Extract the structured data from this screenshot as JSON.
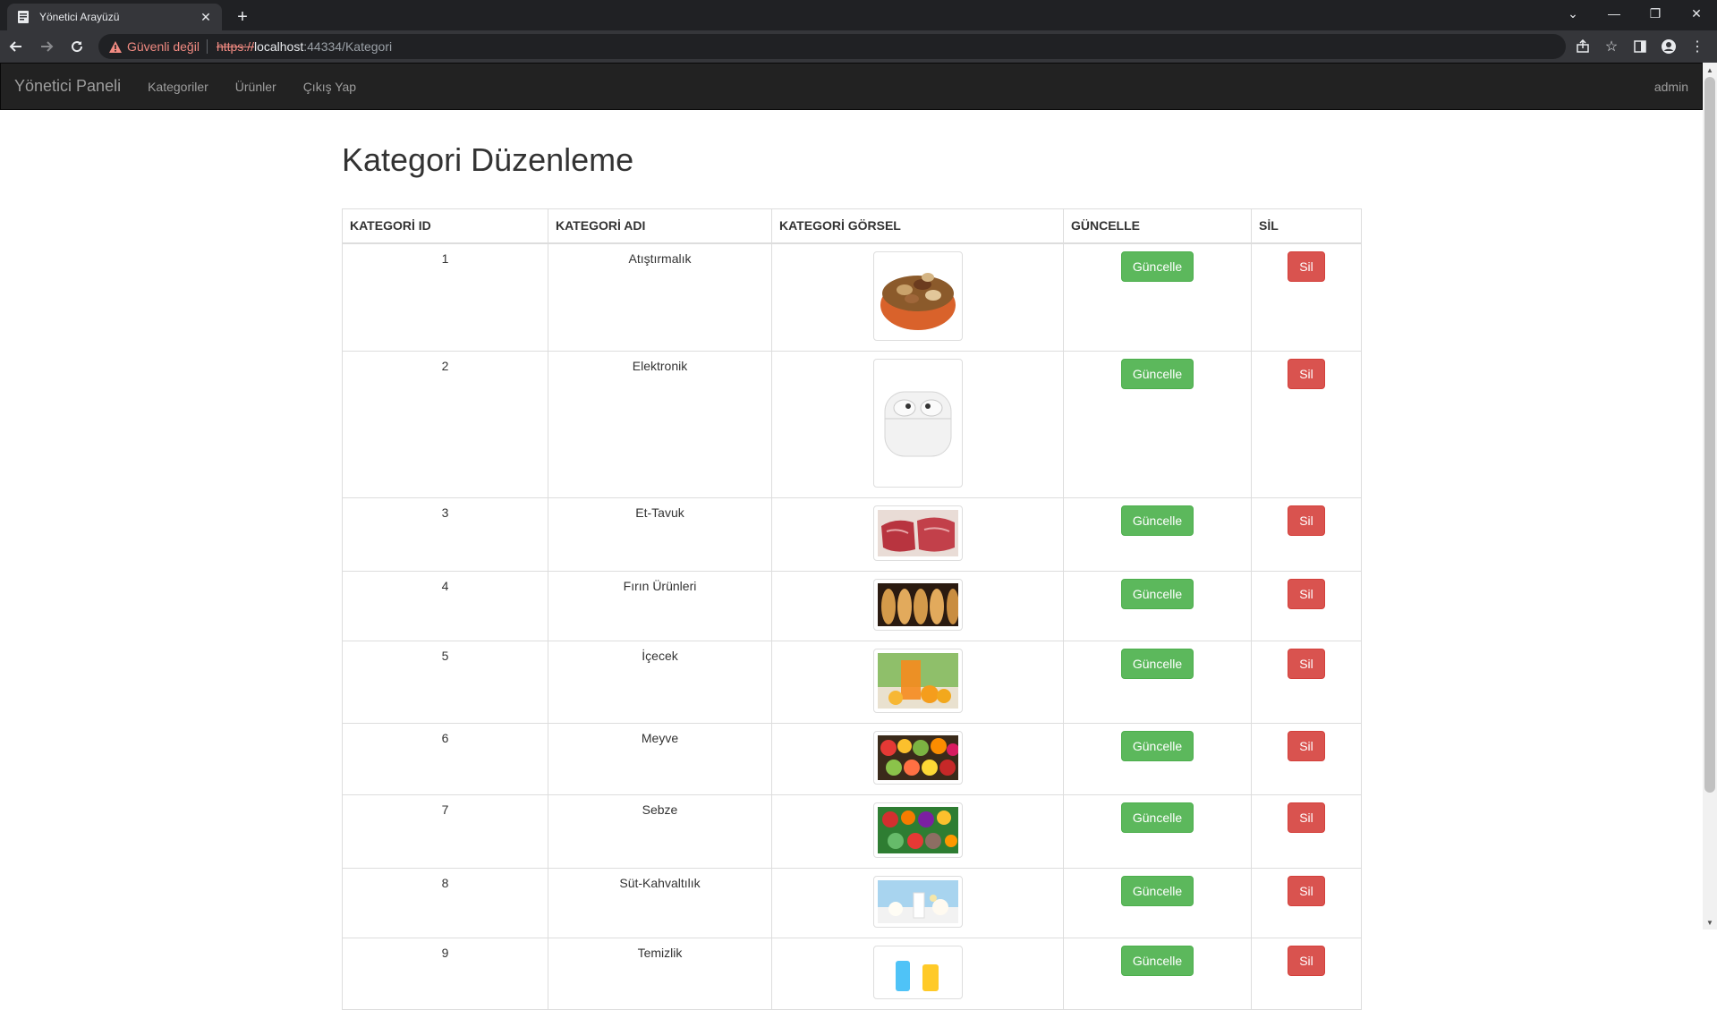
{
  "browser": {
    "tab_title": "Yönetici Arayüzü",
    "security_label": "Güvenli değil",
    "url_scheme": "https://",
    "url_host": "localhost",
    "url_path": ":44334/Kategori"
  },
  "navbar": {
    "brand": "Yönetici Paneli",
    "links": [
      "Kategoriler",
      "Ürünler",
      "Çıkış Yap"
    ],
    "user": "admin"
  },
  "page": {
    "title": "Kategori Düzenleme",
    "columns": [
      "KATEGORİ ID",
      "KATEGORİ ADI",
      "KATEGORİ GÖRSEL",
      "GÜNCELLE",
      "SİL"
    ],
    "update_label": "Güncelle",
    "delete_label": "Sil",
    "rows": [
      {
        "id": "1",
        "name": "Atıştırmalık",
        "image": "nuts-bowl"
      },
      {
        "id": "2",
        "name": "Elektronik",
        "image": "earbuds-case"
      },
      {
        "id": "3",
        "name": "Et-Tavuk",
        "image": "raw-meat"
      },
      {
        "id": "4",
        "name": "Fırın Ürünleri",
        "image": "bread-loaves"
      },
      {
        "id": "5",
        "name": "İçecek",
        "image": "orange-juice"
      },
      {
        "id": "6",
        "name": "Meyve",
        "image": "fruits"
      },
      {
        "id": "7",
        "name": "Sebze",
        "image": "vegetables"
      },
      {
        "id": "8",
        "name": "Süt-Kahvaltılık",
        "image": "dairy"
      },
      {
        "id": "9",
        "name": "Temizlik",
        "image": "cleaning"
      }
    ]
  },
  "colors": {
    "navbar_bg": "#222222",
    "success": "#5cb85c",
    "danger": "#d9534f"
  }
}
